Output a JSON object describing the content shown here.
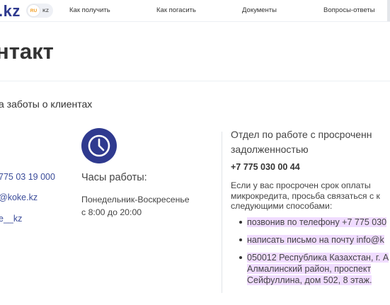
{
  "header": {
    "logo": ".kz",
    "lang": {
      "ru": "RU",
      "kz": "KZ"
    },
    "nav": [
      "Как получить",
      "Как погасить",
      "Документы",
      "Вопросы-ответы"
    ]
  },
  "page_title": "нтакт",
  "subtitle": "а заботы о клиентах",
  "contacts": {
    "phone": "775 03 19 000",
    "email": "@koke.kz",
    "social": "e__kz"
  },
  "hours": {
    "title": "Часы работы:",
    "days": "Понедельник-Воскресенье",
    "time": "с 8:00 до 20:00"
  },
  "department": {
    "title_line1": "Отдел по работе с просроченн",
    "title_line2": "задолженностью",
    "phone": "+7 775 030 00 44",
    "text_line1": "Если у вас просрочен срок оплаты",
    "text_line2": "микрокредита, просьба связаться с к",
    "text_line3": "следующими способами:",
    "methods": [
      {
        "line1": "позвонив по телефону +7 775 030"
      },
      {
        "line1": "написать письмо на почту info@k"
      },
      {
        "line1": "050012 Республика Казахстан, г. А",
        "line2": "Алмалинский район, проспект",
        "line3": "Сейфуллина, дом 502, 8 этаж."
      }
    ]
  },
  "colors": {
    "brand": "#2f3a8f",
    "link": "#3b4c9a",
    "highlight": "#f0dcff",
    "accent": "#f29a1a"
  }
}
